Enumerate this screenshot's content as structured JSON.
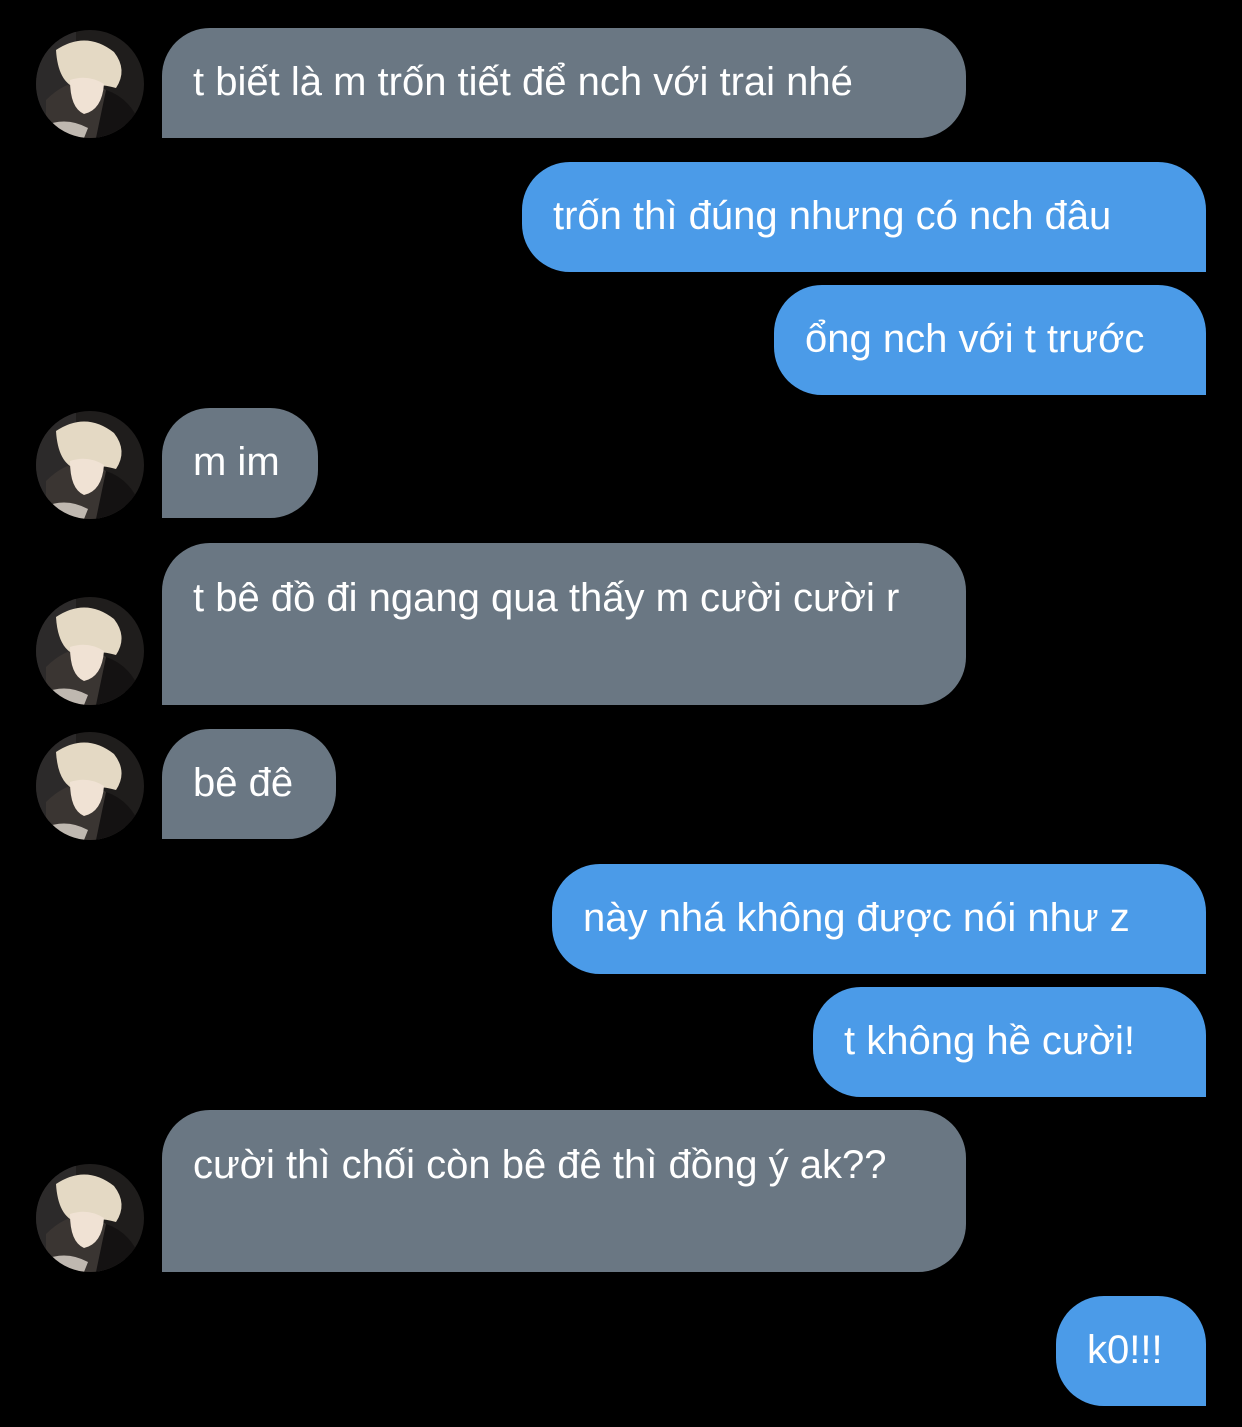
{
  "colors": {
    "background": "#000000",
    "incoming_bubble": "#6a7783",
    "outgoing_bubble": "#4b9be8",
    "text": "#ffffff"
  },
  "messages": [
    {
      "direction": "incoming",
      "text": "t biết là m trốn tiết để nch với trai nhé",
      "avatar": "contact-avatar"
    },
    {
      "direction": "outgoing",
      "text": "trốn thì đúng nhưng có nch đâu"
    },
    {
      "direction": "outgoing",
      "text": "ổng nch với t trước"
    },
    {
      "direction": "incoming",
      "text": "m im",
      "avatar": "contact-avatar"
    },
    {
      "direction": "incoming",
      "text": "t bê đồ đi ngang qua thấy m cười cười r",
      "avatar": "contact-avatar"
    },
    {
      "direction": "incoming",
      "text": "bê đê",
      "avatar": "contact-avatar"
    },
    {
      "direction": "outgoing",
      "text": "này nhá không được nói như z"
    },
    {
      "direction": "outgoing",
      "text": "t không hề cười!"
    },
    {
      "direction": "incoming",
      "text": "cười thì chối còn bê đê thì đồng ý ak??",
      "avatar": "contact-avatar"
    },
    {
      "direction": "outgoing",
      "text": "k0!!!"
    }
  ]
}
